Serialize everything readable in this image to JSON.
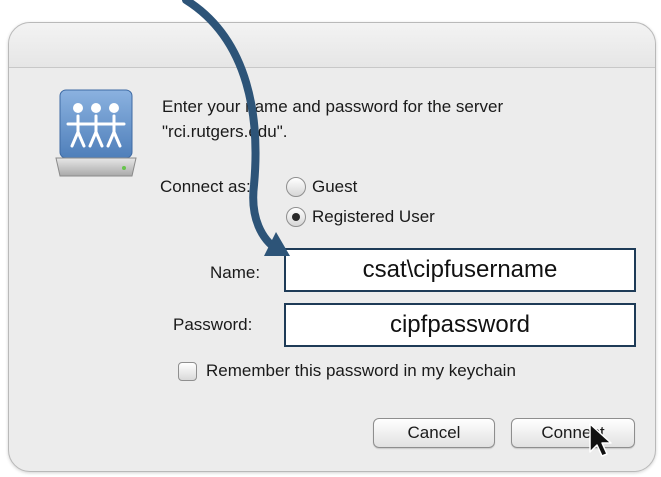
{
  "dialog": {
    "prompt_line1": "Enter your name and password for the server",
    "prompt_line2": "\"rci.rutgers.edu\".",
    "connect_as_label": "Connect as:",
    "options": [
      {
        "label": "Guest",
        "selected": false
      },
      {
        "label": "Registered User",
        "selected": true
      }
    ],
    "name_label": "Name:",
    "name_value": "csat\\cipfusername",
    "password_label": "Password:",
    "password_value": "cipfpassword",
    "remember_label": "Remember this password in my keychain",
    "remember_checked": false,
    "cancel_label": "Cancel",
    "connect_label": "Connect"
  },
  "icons": {
    "server": "shared-server-icon",
    "pointer": "mouse-pointer-icon",
    "annotation": "curved-arrow-icon"
  },
  "colors": {
    "annotation_arrow": "#2d5478",
    "field_border": "#1e3b57",
    "icon_body": "#6f9bd1"
  }
}
